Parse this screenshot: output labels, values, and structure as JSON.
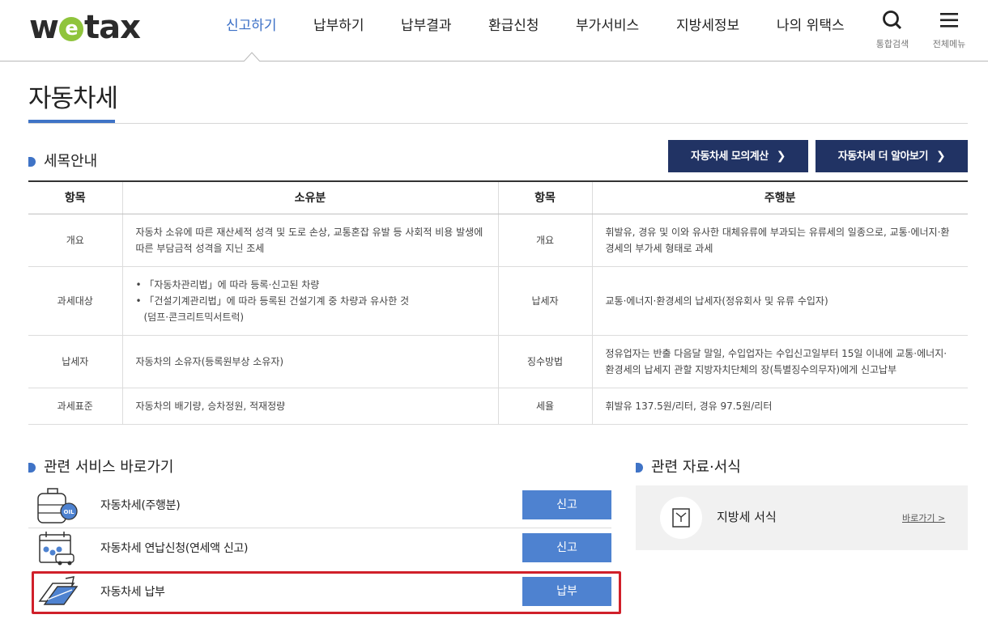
{
  "header": {
    "logo_prefix": "w",
    "logo_e": "e",
    "logo_suffix": "tax",
    "nav": [
      {
        "label": "신고하기",
        "active": true
      },
      {
        "label": "납부하기"
      },
      {
        "label": "납부결과"
      },
      {
        "label": "환급신청"
      },
      {
        "label": "부가서비스"
      },
      {
        "label": "지방세정보"
      },
      {
        "label": "나의 위택스"
      }
    ],
    "search_label": "통합검색",
    "menu_label": "전체메뉴",
    "accent": "#3b6fc6"
  },
  "page": {
    "title": "자동차세"
  },
  "guide": {
    "heading": "세목안내",
    "btn_simulate": "자동차세 모의계산",
    "btn_more": "자동차세 더 알아보기",
    "columns": [
      "항목",
      "소유분",
      "항목",
      "주행분"
    ],
    "rows": [
      {
        "k1": "개요",
        "v1": "자동차 소유에 따른 재산세적 성격 및 도로 손상, 교통혼잡 유발 등 사회적 비용 발생에 따른 부담금적 성격을 지닌 조세",
        "k2": "개요",
        "v2": "휘발유, 경유 및 이와 유사한 대체유류에 부과되는 유류세의 일종으로, 교통·에너지·환경세의 부가세 형태로 과세"
      },
      {
        "k1": "과세대상",
        "v1_line1": "• 「자동차관리법」에 따라 등록·신고된 차량",
        "v1_line2": "• 「건설기계관리법」에 따라 등록된 건설기계 중 차량과 유사한 것",
        "v1_line3": "(덤프·콘크리트믹서트럭)",
        "k2": "납세자",
        "v2": "교통·에너지·환경세의 납세자(정유회사 및 유류 수입자)"
      },
      {
        "k1": "납세자",
        "v1": "자동차의 소유자(등록원부상 소유자)",
        "k2": "징수방법",
        "v2": "정유업자는 반출 다음달 말일, 수입업자는 수입신고일부터 15일 이내에 교통·에너지·환경세의 납세지 관할 지방자치단체의 장(특별징수의무자)에게 신고납부"
      },
      {
        "k1": "과세표준",
        "v1": "자동차의 배기량, 승차정원, 적재정량",
        "k2": "세율",
        "v2": "휘발유 137.5원/리터, 경유 97.5원/리터"
      }
    ]
  },
  "services": {
    "heading": "관련 서비스 바로가기",
    "items": [
      {
        "label": "자동차세(주행분)",
        "button": "신고",
        "icon": "oil-tank-icon"
      },
      {
        "label": "자동차세 연납신청(연세액 신고)",
        "button": "신고",
        "icon": "calendar-car-icon"
      },
      {
        "label": "자동차세 납부",
        "button": "납부",
        "icon": "card-payment-icon"
      }
    ],
    "highlight_color": "#d0202a"
  },
  "resources": {
    "heading": "관련 자료·서식",
    "item_label": "지방세 서식",
    "link": "바로가기 >"
  }
}
